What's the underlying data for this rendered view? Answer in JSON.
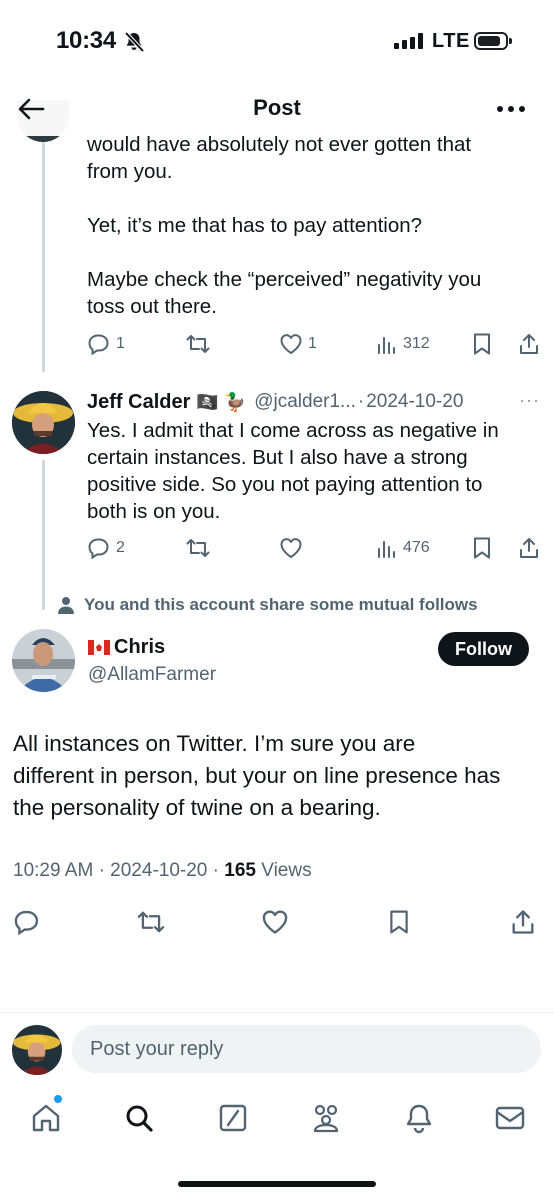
{
  "status_bar": {
    "time": "10:34",
    "network": "LTE",
    "icons": [
      "bell-off-icon",
      "signal-icon",
      "battery-icon"
    ]
  },
  "header": {
    "title": "Post",
    "back_icon": "arrow-left-icon",
    "more_icon": "more-dots-icon"
  },
  "prev_tweet": {
    "text_lines": [
      "would have absolutely not ever gotten that",
      "from you.",
      "",
      "Yet, it’s me that has to pay attention?",
      "",
      "Maybe check the “perceived” negativity you",
      "toss out there."
    ],
    "replies": "1",
    "reposts": "",
    "likes": "1",
    "views": "312"
  },
  "reply_tweet": {
    "author_name": "Jeff Calder",
    "author_emoji": "🏴‍☠️ 🦆",
    "handle": "@jcalder1...",
    "separator": "·",
    "date": "2024-10-20",
    "more": "···",
    "text_lines": [
      "Yes. I admit that I come across as negative in",
      "certain instances. But I also have a strong",
      "positive side. So you not paying attention to",
      "both is on you."
    ],
    "replies": "2",
    "reposts": "",
    "likes": "",
    "views": "476"
  },
  "mutual_note": "You and this account share some mutual follows",
  "main_tweet": {
    "author_name": "Chris",
    "handle": "@AllamFarmer",
    "follow_label": "Follow",
    "text_lines": [
      "All instances on Twitter. I’m sure you are",
      "different in person, but your on line presence has",
      "the personality of twine on a bearing."
    ],
    "time": "10:29 AM",
    "date": "2024-10-20",
    "views_count": "165",
    "views_label": "Views",
    "sep": "·"
  },
  "reply_bar": {
    "placeholder": "Post your reply"
  },
  "tabs": [
    "home-icon",
    "search-icon",
    "grok-icon",
    "communities-icon",
    "notifications-icon",
    "messages-icon"
  ],
  "colors": {
    "text": "#0f1419",
    "secondary": "#536471",
    "accent": "#1d9bf0",
    "thread_line": "#cfd9de"
  }
}
